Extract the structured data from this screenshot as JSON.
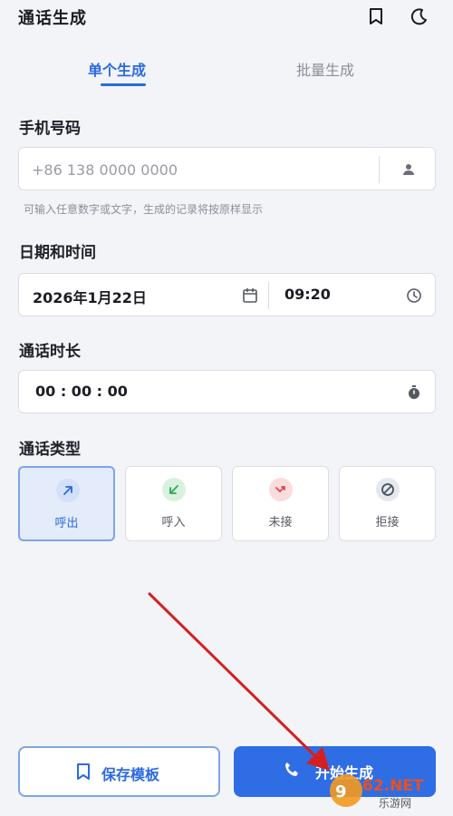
{
  "header": {
    "title": "通话生成",
    "icons": [
      "bookmark-icon",
      "moon-icon"
    ]
  },
  "tabs": [
    {
      "label": "单个生成",
      "active": true
    },
    {
      "label": "批量生成",
      "active": false
    }
  ],
  "phone": {
    "label": "手机号码",
    "placeholder": "+86 138 0000 0000",
    "value": "",
    "hint": "可输入任意数字或文字，生成的记录将按原样显示",
    "icon": "contact-icon"
  },
  "datetime": {
    "label": "日期和时间",
    "date": "2026年1月22日",
    "date_icon": "calendar-icon",
    "time": "09:20",
    "time_icon": "clock-icon"
  },
  "duration": {
    "label": "通话时长",
    "value": "00 : 00 : 00",
    "icon": "stopwatch-icon"
  },
  "call_type": {
    "label": "通话类型",
    "options": [
      {
        "label": "呼出",
        "icon": "outgoing-arrow-icon",
        "selected": true,
        "color": "#2a6ae0"
      },
      {
        "label": "呼入",
        "icon": "incoming-arrow-icon",
        "selected": false,
        "color": "#2ea94f"
      },
      {
        "label": "未接",
        "icon": "missed-call-icon",
        "selected": false,
        "color": "#e0454a"
      },
      {
        "label": "拒接",
        "icon": "block-icon",
        "selected": false,
        "color": "#4a5060"
      }
    ]
  },
  "actions": {
    "save_label": "保存模板",
    "save_icon": "bookmark-icon",
    "start_label": "开始生成",
    "start_icon": "phone-icon"
  },
  "watermark": {
    "brand": "962.NET",
    "sub": "乐游网"
  },
  "colors": {
    "accent": "#2a6ae0",
    "background": "#f3f4f8",
    "annotation": "#d42020"
  }
}
